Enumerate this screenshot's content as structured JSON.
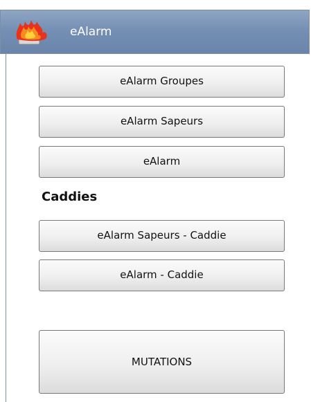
{
  "header": {
    "title": "eAlarm",
    "logo_icon": "flame-icon"
  },
  "buttons": {
    "groupes": "eAlarm Groupes",
    "sapeurs": "eAlarm Sapeurs",
    "ealarm": "eAlarm"
  },
  "caddies": {
    "section_label": "Caddies",
    "sapeurs_caddie": "eAlarm Sapeurs - Caddie",
    "ealarm_caddie": "eAlarm - Caddie"
  },
  "mutations": {
    "label": "MUTATIONS"
  },
  "colors": {
    "header_bg": "#7590b4",
    "header_text": "#ffffff",
    "button_border": "#777777"
  }
}
